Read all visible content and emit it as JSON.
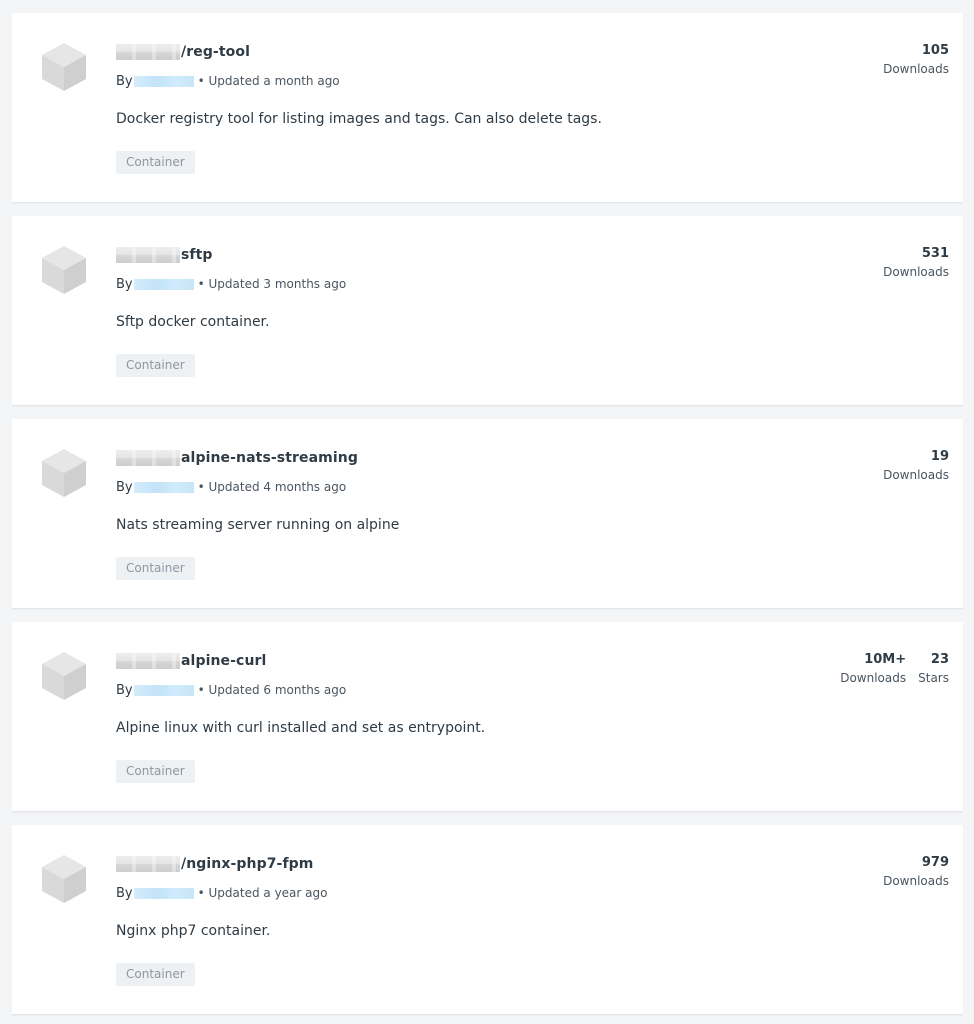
{
  "repositories": [
    {
      "name": "/reg-tool",
      "by_label": "By",
      "updated": "• Updated a month ago",
      "description": "Docker registry tool for listing images and tags. Can also delete tags.",
      "tag": "Container",
      "stats": [
        {
          "value": "105",
          "label": "Downloads"
        }
      ]
    },
    {
      "name": "sftp",
      "by_label": "By",
      "updated": "• Updated 3 months ago",
      "description": "Sftp docker container.",
      "tag": "Container",
      "stats": [
        {
          "value": "531",
          "label": "Downloads"
        }
      ]
    },
    {
      "name": "alpine-nats-streaming",
      "by_label": "By",
      "updated": "• Updated 4 months ago",
      "description": "Nats streaming server running on alpine",
      "tag": "Container",
      "stats": [
        {
          "value": "19",
          "label": "Downloads"
        }
      ]
    },
    {
      "name": "alpine-curl",
      "by_label": "By",
      "updated": "• Updated 6 months ago",
      "description": "Alpine linux with curl installed and set as entrypoint.",
      "tag": "Container",
      "stats": [
        {
          "value": "10M+",
          "label": "Downloads"
        },
        {
          "value": "23",
          "label": "Stars"
        }
      ]
    },
    {
      "name": "/nginx-php7-fpm",
      "by_label": "By",
      "updated": "• Updated a year ago",
      "description": "Nginx php7 container.",
      "tag": "Container",
      "stats": [
        {
          "value": "979",
          "label": "Downloads"
        }
      ]
    }
  ]
}
